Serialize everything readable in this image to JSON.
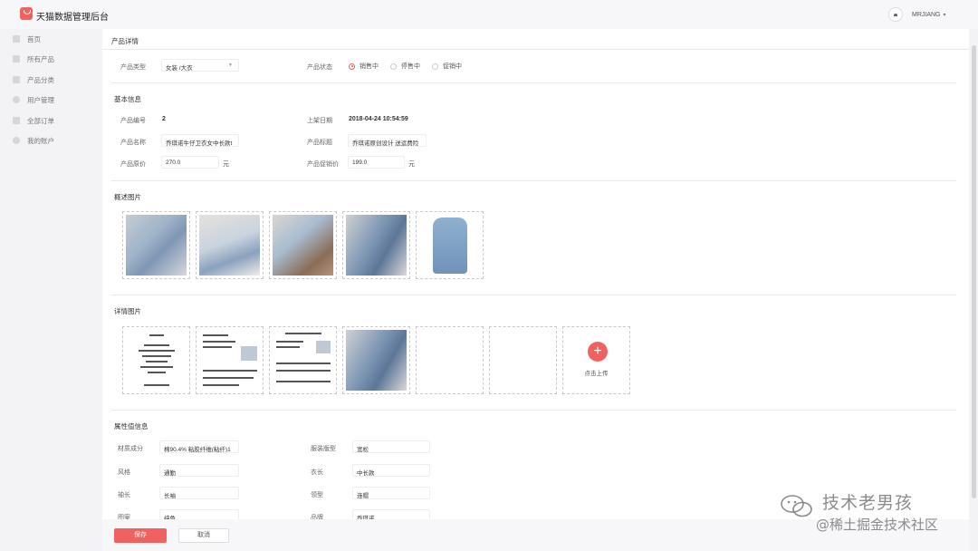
{
  "header": {
    "brand": "天猫数据管理后台",
    "user": "MRJIANG",
    "caret": "▾"
  },
  "sidebar": {
    "items": [
      {
        "label": "首页",
        "icon": "home-icon"
      },
      {
        "label": "所有产品",
        "icon": "product-icon"
      },
      {
        "label": "产品分类",
        "icon": "category-icon"
      },
      {
        "label": "用户管理",
        "icon": "user-icon"
      },
      {
        "label": "全部订单",
        "icon": "order-icon"
      },
      {
        "label": "我的账户",
        "icon": "account-icon"
      }
    ]
  },
  "main": {
    "title": "产品详情",
    "type": {
      "label": "产品类型",
      "value": "女装 /大衣"
    },
    "status": {
      "label": "产品状态",
      "options": [
        "销售中",
        "停售中",
        "促销中"
      ],
      "selected": "销售中"
    },
    "basic": {
      "title": "基本信息",
      "id": {
        "label": "产品编号",
        "value": "2"
      },
      "date": {
        "label": "上架日期",
        "value": "2018-04-24 10:54:59"
      },
      "name": {
        "label": "产品名称",
        "value": "乔琪诺牛仔卫衣女中长款t"
      },
      "subtitle": {
        "label": "产品标题",
        "value": "乔琪诺原创设计 送运费险"
      },
      "price": {
        "label": "产品原价",
        "value": "270.0",
        "unit": "元"
      },
      "promo": {
        "label": "产品促销价",
        "value": "199.0",
        "unit": "元"
      }
    },
    "overview_images": {
      "title": "概述图片"
    },
    "detail_images": {
      "title": "详情图片",
      "upload_label": "点击上传",
      "upload_plus": "+"
    },
    "attributes": {
      "title": "属性值信息",
      "rows": [
        {
          "label": "材质成分",
          "value": "棉90.4% 粘胶纤维(粘纤)1"
        },
        {
          "label": "服装版型",
          "value": "宽松"
        },
        {
          "label": "风格",
          "value": "通勤"
        },
        {
          "label": "衣长",
          "value": "中长款"
        },
        {
          "label": "袖长",
          "value": "长袖"
        },
        {
          "label": "领型",
          "value": "连帽"
        },
        {
          "label": "图案",
          "value": "纯色"
        },
        {
          "label": "品牌",
          "value": "乔琪诺"
        }
      ]
    }
  },
  "footer": {
    "save": "保存",
    "cancel": "取消"
  },
  "watermark": {
    "line1": "技术老男孩",
    "line2": "@稀土掘金技术社区"
  },
  "colors": {
    "accent": "#f0625f",
    "sidebar_bg": "#f3f3f5",
    "content_bg": "#ffffff"
  }
}
